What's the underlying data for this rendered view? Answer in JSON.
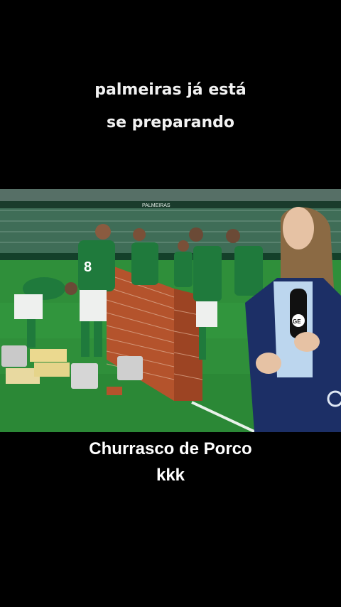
{
  "captions": {
    "top_line1": "palmeiras já está",
    "top_line2": "se preparando",
    "bottom_line1": "Churrasco de Porco",
    "bottom_line2": "kkk"
  },
  "scene": {
    "stadium_ads": "PALMEIRAS",
    "jersey_number": "8",
    "broadcaster_logo": "GE"
  },
  "colors": {
    "background": "#000000",
    "pitch": "#2f8f3a",
    "jersey": "#1f7a3c",
    "brick": "#b4532c",
    "blazer": "#1c2f66"
  }
}
